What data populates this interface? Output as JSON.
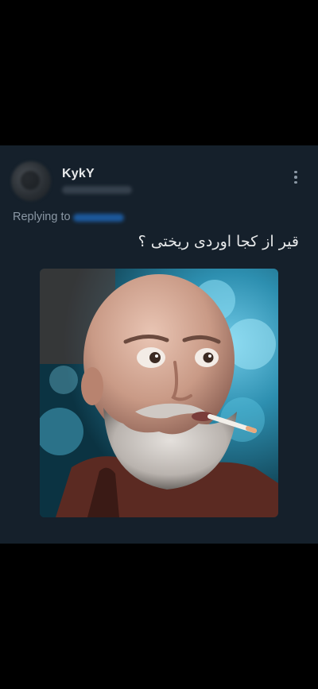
{
  "tweet": {
    "display_name": "KykY",
    "replying_to_label": "Replying to",
    "text": "قیر از کجا اوردی ریختی ؟",
    "more_icon": "more-vertical-icon"
  },
  "colors": {
    "card_background": "#15202b",
    "page_background": "#000000",
    "primary_text": "#e7e9ea",
    "secondary_text": "#8b98a5",
    "link": "#1d9bf0"
  }
}
